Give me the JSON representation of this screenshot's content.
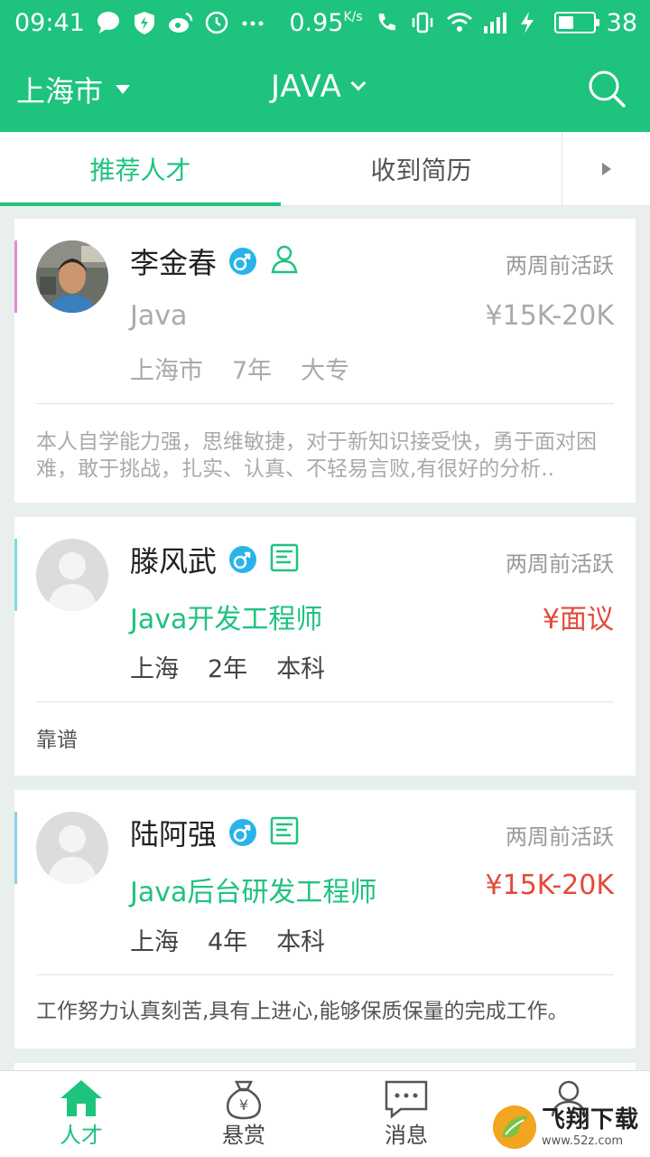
{
  "status_bar": {
    "time": "09:41",
    "network_speed": "0.95",
    "network_unit": "K/s",
    "battery": "38"
  },
  "header": {
    "city": "上海市",
    "keyword": "JAVA"
  },
  "tabs": [
    {
      "label": "推荐人才",
      "active": true
    },
    {
      "label": "收到简历",
      "active": false
    }
  ],
  "cards": [
    {
      "name": "李金春",
      "active_time": "两周前活跃",
      "title": "Java",
      "salary": "¥15K-20K",
      "city": "上海市",
      "experience": "7年",
      "education": "大专",
      "description": "本人自学能力强，思维敏捷，对于新知识接受快，勇于面对困难，敢于挑战，扎实、认真、不轻易言败,有很好的分析..",
      "accent_color": "#e48ad9"
    },
    {
      "name": "滕风武",
      "active_time": "两周前活跃",
      "title": "Java开发工程师",
      "salary": "¥面议",
      "city": "上海",
      "experience": "2年",
      "education": "本科",
      "description": "靠谱",
      "accent_color": "#7fd9ea"
    },
    {
      "name": "陆阿强",
      "active_time": "两周前活跃",
      "title": "Java后台研发工程师",
      "salary": "¥15K-20K",
      "city": "上海",
      "experience": "4年",
      "education": "本科",
      "description": "工作努力认真刻苦,具有上进心,能够保质保量的完成工作。",
      "accent_color": "#8ed0f0"
    }
  ],
  "bottom_nav": [
    {
      "label": "人才",
      "icon": "home-icon",
      "active": true
    },
    {
      "label": "悬赏",
      "icon": "money-bag-icon",
      "active": false
    },
    {
      "label": "消息",
      "icon": "chat-icon",
      "active": false
    },
    {
      "label": "",
      "icon": "profile-icon",
      "active": false
    }
  ],
  "watermark": {
    "text": "飞翔下载",
    "url": "www.52z.com"
  },
  "colors": {
    "brand": "#1ec37e",
    "salary_red": "#e34a3a",
    "gender_blue": "#29b4e8"
  }
}
